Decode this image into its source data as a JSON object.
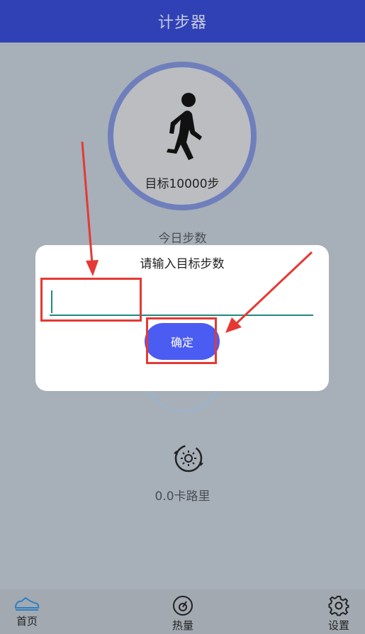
{
  "header": {
    "title": "计步器"
  },
  "main": {
    "goal_text": "目标10000步",
    "today_label": "今日步数",
    "calories_text": "0.0卡路里"
  },
  "dialog": {
    "title": "请输入目标步数",
    "input_value": "",
    "confirm_label": "确定"
  },
  "bottom_nav": {
    "items": [
      {
        "label": "首页",
        "icon": "shoe-icon"
      },
      {
        "label": "热量",
        "icon": "scale-icon"
      },
      {
        "label": "设置",
        "icon": "gear-icon"
      }
    ]
  },
  "colors": {
    "topbar": "#3041b6",
    "accent_button": "#4b5cf2",
    "input_underline": "#1f8a7f",
    "annotation": "#e53935"
  }
}
